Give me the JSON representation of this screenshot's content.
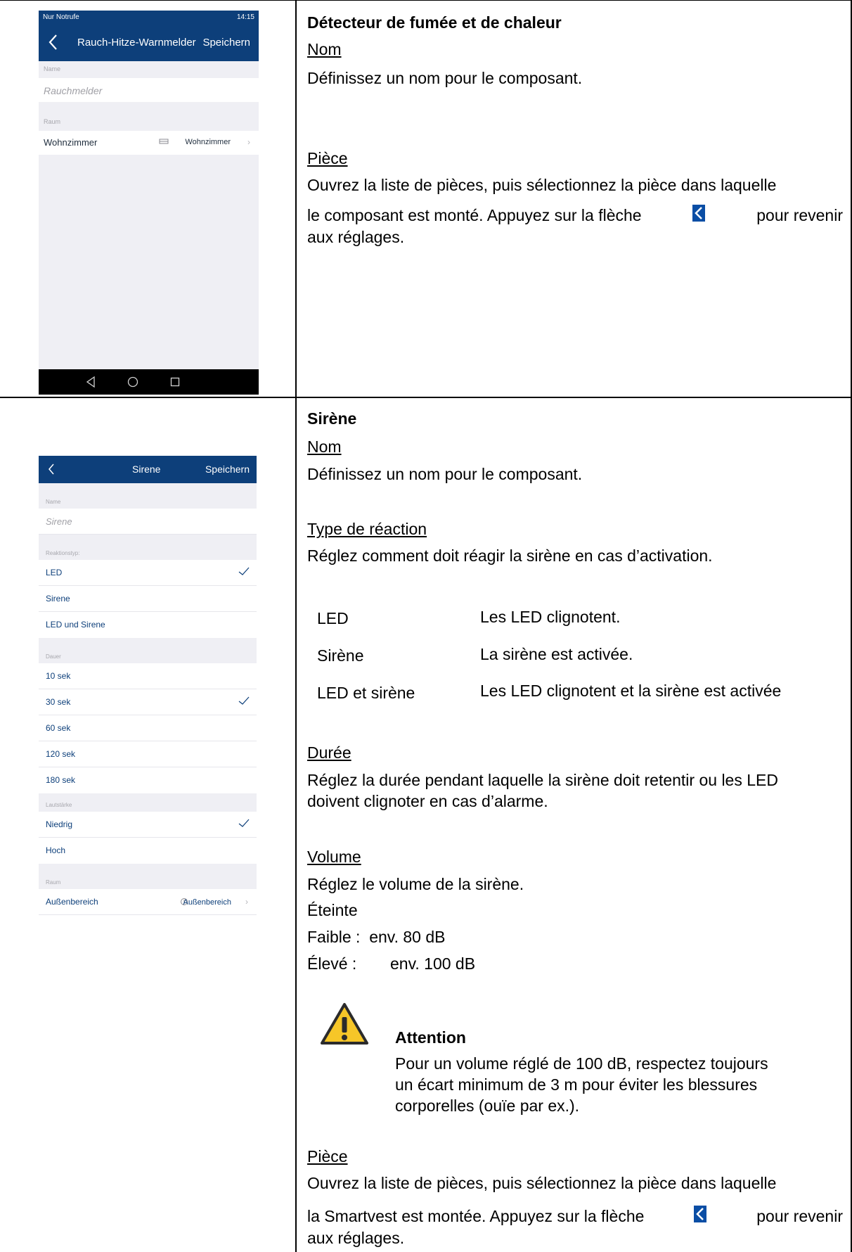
{
  "phone1": {
    "status_left": "Nur Notrufe",
    "status_time": "14:15",
    "nav_title": "Rauch-Hitze-Warnmelder",
    "nav_save": "Speichern",
    "name_label": "Name",
    "name_value": "Rauchmelder",
    "room_label": "Raum",
    "room_left": "Wohnzimmer",
    "room_right": "Wohnzimmer"
  },
  "phone2": {
    "nav_title": "Sirene",
    "nav_save": "Speichern",
    "name_label": "Name",
    "name_value": "Sirene",
    "reaction_label": "Reaktionstyp:",
    "reaction_items": [
      "LED",
      "Sirene",
      "LED und Sirene"
    ],
    "duration_label": "Dauer",
    "duration_items": [
      "10 sek",
      "30 sek",
      "60 sek",
      "120 sek",
      "180 sek"
    ],
    "volume_label": "Lautstärke",
    "volume_items": [
      "Niedrig",
      "Hoch"
    ],
    "room_label": "Raum",
    "room_left": "Außenbereich",
    "room_right": "Außenbereich"
  },
  "section1": {
    "heading": "Détecteur de fumée et de chaleur",
    "name_title": "Nom",
    "name_text": "Définissez un nom pour le composant.",
    "room_title": "Pièce",
    "room_text_1": "Ouvrez la liste de pièces, puis sélectionnez la pièce dans laquelle",
    "room_text_2a": "le composant est monté. Appuyez sur la flèche",
    "room_text_2b": "pour revenir",
    "room_text_3": "aux réglages."
  },
  "section2": {
    "heading": "Sirène",
    "name_title": "Nom",
    "name_text": "Définissez un nom pour le composant.",
    "reaction_title": "Type de réaction",
    "reaction_text": "Réglez comment doit réagir la sirène en cas d’activation.",
    "reaction_rows": [
      {
        "term": "LED",
        "desc": "Les LED clignotent."
      },
      {
        "term": "Sirène",
        "desc": "La sirène est activée."
      },
      {
        "term": "LED et sirène",
        "desc": "Les LED clignotent et la sirène est activée"
      }
    ],
    "duration_title": "Durée",
    "duration_text_1": "Réglez la durée pendant laquelle la sirène doit retentir ou les LED",
    "duration_text_2": "doivent clignoter en cas d’alarme.",
    "volume_title": "Volume",
    "volume_text": "Réglez le volume de la sirène.",
    "volume_off": "Éteinte",
    "volume_low": "Faible :  env. 80 dB",
    "volume_high_label": "Élevé :",
    "volume_high_value": "env. 100 dB",
    "attention_title": "Attention",
    "attention_1": "Pour un volume réglé de 100 dB, respectez toujours",
    "attention_2": "un écart minimum de 3 m pour éviter les blessures",
    "attention_3": "corporelles (ouïe par ex.).",
    "room_title": "Pièce",
    "room_text_1": "Ouvrez la liste de pièces, puis sélectionnez la pièce dans laquelle",
    "room_text_2a": "la Smartvest est montée. Appuyez sur la flèche",
    "room_text_2b": "pour revenir",
    "room_text_3": "aux réglages."
  },
  "colors": {
    "app_blue": "#0d3f7a",
    "arrow_blue": "#0a4ea5",
    "warning_yellow": "#f6c628"
  }
}
